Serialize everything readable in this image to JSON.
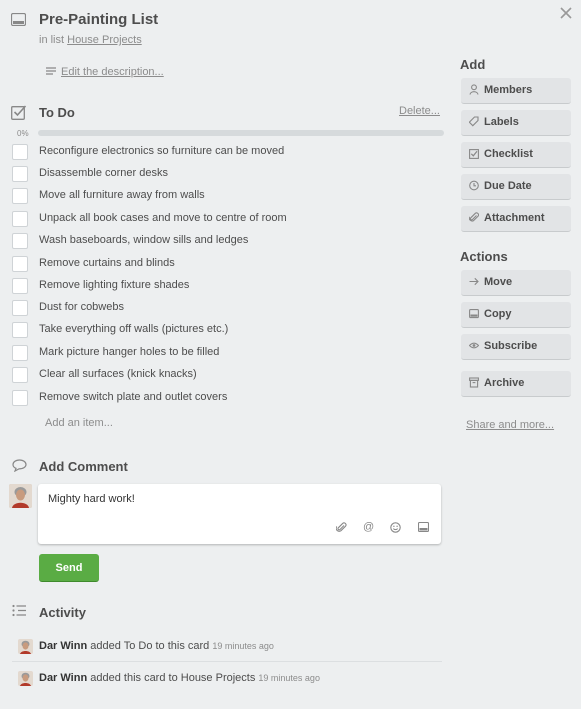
{
  "card": {
    "title": "Pre-Painting List",
    "in_list_prefix": "in list",
    "list_name": "House Projects",
    "edit_description": "Edit the description..."
  },
  "checklist": {
    "title": "To Do",
    "delete_label": "Delete...",
    "progress_label": "0%",
    "progress_fraction": 0,
    "items": [
      "Reconfigure electronics so furniture can be moved",
      "Disassemble corner desks",
      "Move all furniture away from walls",
      "Unpack all book cases and move to centre of room",
      "Wash baseboards, window sills and ledges",
      "Remove curtains and blinds",
      "Remove lighting fixture shades",
      "Dust for cobwebs",
      "Take everything off walls (pictures etc.)",
      "Mark picture hanger holes to be filled",
      "Clear all surfaces (knick knacks)",
      "Remove switch plate and outlet covers"
    ],
    "add_item": "Add an item..."
  },
  "comment": {
    "title": "Add Comment",
    "value": "Mighty hard work!",
    "send_label": "Send"
  },
  "activity": {
    "title": "Activity",
    "entries": [
      {
        "user": "Dar Winn",
        "text": "added To Do to this card",
        "time": "19 minutes ago"
      },
      {
        "user": "Dar Winn",
        "text": "added this card to House Projects",
        "time": "19 minutes ago"
      }
    ]
  },
  "sidebar": {
    "add_heading": "Add",
    "add_buttons": [
      "Members",
      "Labels",
      "Checklist",
      "Due Date",
      "Attachment"
    ],
    "actions_heading": "Actions",
    "action_buttons": [
      "Move",
      "Copy",
      "Subscribe",
      "Archive"
    ],
    "share_more": "Share and more..."
  },
  "colors": {
    "background": "#edeff0",
    "send_button": "#5aac44",
    "sidebar_button": "#e2e4e6"
  }
}
